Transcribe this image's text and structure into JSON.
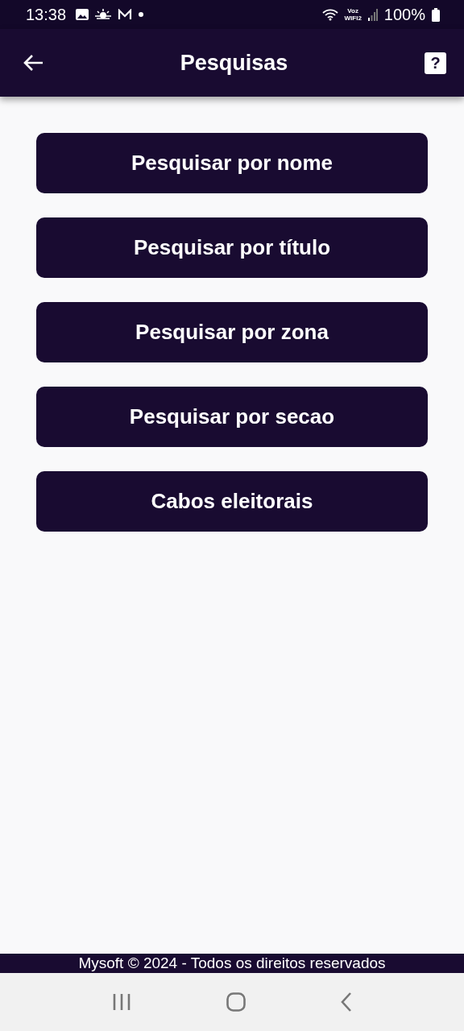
{
  "status_bar": {
    "time": "13:38",
    "network_top": "Voz",
    "network_bottom": "WIFI2",
    "battery": "100%"
  },
  "app_bar": {
    "title": "Pesquisas",
    "help_label": "?"
  },
  "buttons": [
    {
      "label": "Pesquisar por nome"
    },
    {
      "label": "Pesquisar por título"
    },
    {
      "label": "Pesquisar por zona"
    },
    {
      "label": "Pesquisar por secao"
    },
    {
      "label": "Cabos eleitorais"
    }
  ],
  "footer": "Mysoft © 2024 - Todos os direitos reservados"
}
